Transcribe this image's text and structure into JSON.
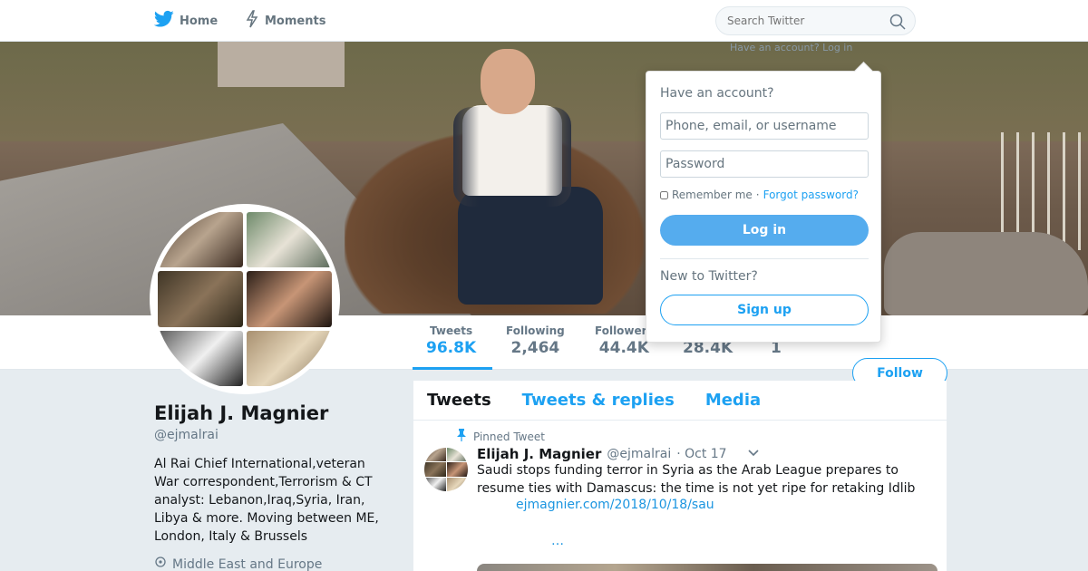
{
  "nav": {
    "home_label": "Home",
    "moments_label": "Moments"
  },
  "search": {
    "placeholder": "Search Twitter"
  },
  "signin_hint": "Have an account? Log in",
  "stats": [
    {
      "label": "Tweets",
      "value": "96.8K",
      "active": true
    },
    {
      "label": "Following",
      "value": "2,464"
    },
    {
      "label": "Followers",
      "value": "44.4K"
    },
    {
      "label": "",
      "value": "28.4K"
    },
    {
      "label": "",
      "value": "1"
    }
  ],
  "follow_label": "Follow",
  "profile": {
    "name": "Elijah J. Magnier",
    "handle": "@ejmalrai",
    "bio": "Al Rai Chief International,veteran War correspondent,Terrorism & CT analyst: Lebanon,Iraq,Syria, Iran, Libya & more. Moving between ME, London, Italy & Brussels",
    "location": "Middle East and Europe"
  },
  "timeline": {
    "tabs": [
      {
        "label": "Tweets",
        "active": true
      },
      {
        "label": "Tweets & replies"
      },
      {
        "label": "Media"
      }
    ],
    "pinned_label": "Pinned Tweet",
    "tweet": {
      "name": "Elijah J. Magnier",
      "handle": "@ejmalrai",
      "date": "· Oct 17",
      "text": "Saudi stops funding terror in Syria as the Arab League prepares to resume ties with Damascus: the time is not yet ripe for retaking Idlib",
      "link": "ejmagnier.com/2018/10/18/sau",
      "ellipsis": "…"
    }
  },
  "login": {
    "title": "Have an account?",
    "username_placeholder": "Phone, email, or username",
    "password_placeholder": "Password",
    "remember_label": "Remember me",
    "separator": "·",
    "forgot_label": "Forgot password?",
    "login_label": "Log in",
    "new_label": "New to Twitter?",
    "signup_label": "Sign up"
  },
  "colors": {
    "accent": "#1da1f2",
    "login_button": "#55acee",
    "background": "#e6ecf0"
  }
}
